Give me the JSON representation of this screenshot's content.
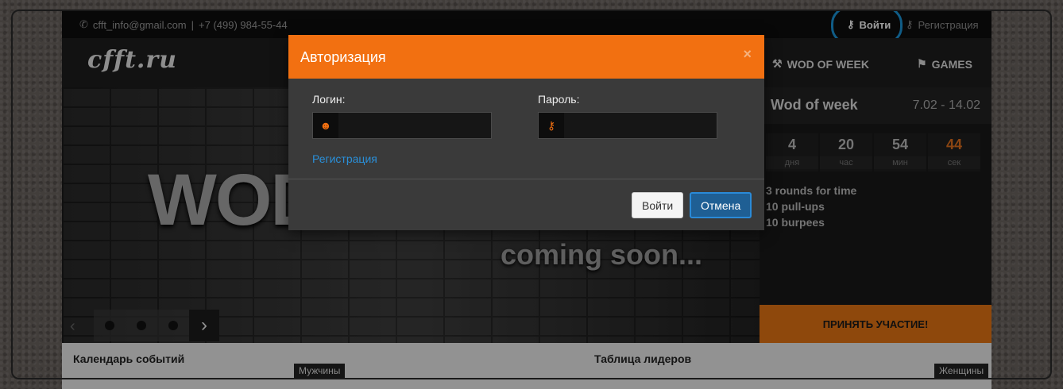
{
  "topbar": {
    "email": "cfft_info@gmail.com",
    "separator": "|",
    "phone": "+7 (499) 984-55-44",
    "login_label": "Войти",
    "register_label": "Регистрация"
  },
  "header": {
    "logo": "cfft.ru",
    "nav": [
      "WOD OF WEEK",
      "GAMES"
    ]
  },
  "hero": {
    "big_text": "WOD",
    "subtitle": "coming soon...",
    "next_arrow": "›",
    "prev_arrow": "‹"
  },
  "wod": {
    "title": "Wod of week",
    "dates": "7.02 - 14.02",
    "counter": [
      {
        "value": "4",
        "unit": "дня"
      },
      {
        "value": "20",
        "unit": "час"
      },
      {
        "value": "54",
        "unit": "мин"
      },
      {
        "value": "44",
        "unit": "сек"
      }
    ],
    "workout": [
      "3 rounds for time",
      "10 pull-ups",
      "10 burpees"
    ],
    "cta": "ПРИНЯТЬ УЧАСТИЕ!"
  },
  "footer": {
    "calendar": "Календарь событий",
    "leaders": "Таблица лидеров",
    "badge_men": "Мужчины",
    "badge_women": "Женщины"
  },
  "modal": {
    "title": "Авторизация",
    "close": "×",
    "login_label": "Логин:",
    "login_value": "",
    "password_label": "Пароль:",
    "password_value": "",
    "register_link": "Регистрация",
    "submit": "Войти",
    "cancel": "Отмена"
  },
  "colors": {
    "accent": "#f27011",
    "link": "#2a8fd8",
    "cancel_button": "#1f5f94",
    "highlight_ring": "#1a95d9"
  },
  "icons": {
    "phone": "phone-icon",
    "key": "key-icon",
    "user": "user-icon",
    "flag": "flag-icon",
    "hammer": "hammer-icon"
  }
}
